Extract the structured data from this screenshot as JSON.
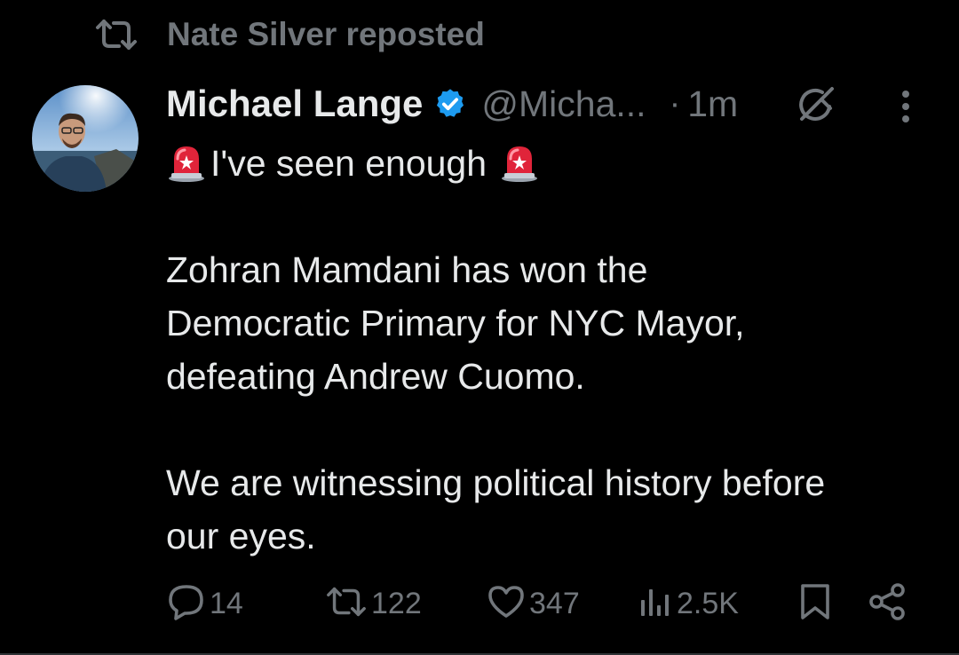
{
  "repost": {
    "icon": "repost-icon",
    "label": "Nate Silver reposted"
  },
  "author": {
    "avatar": "profile-photo",
    "name": "Michael Lange",
    "verified_icon": "verified-badge-icon",
    "verified_color": "#1d9bf0",
    "handle": "@Micha...",
    "separator": "·",
    "time": "1m"
  },
  "icons": {
    "grok": "grok-icon",
    "more": "more-options-icon",
    "siren": "police-siren-emoji"
  },
  "post": {
    "line1": "I've seen enough",
    "line2": "Zohran Mamdani has won the",
    "line3": "Democratic Primary for NYC Mayor,",
    "line4": "defeating Andrew Cuomo.",
    "line5": "We are witnessing political history before",
    "line6": "our eyes."
  },
  "actions": {
    "reply": {
      "icon": "reply-icon",
      "count": "14"
    },
    "repost": {
      "icon": "repost-icon",
      "count": "122"
    },
    "like": {
      "icon": "like-heart-icon",
      "count": "347"
    },
    "views": {
      "icon": "views-bar-chart-icon",
      "count": "2.5K"
    },
    "bookmark": {
      "icon": "bookmark-icon"
    },
    "share": {
      "icon": "share-icon"
    }
  },
  "colors": {
    "background": "#000000",
    "primary_text": "#e7e9ea",
    "secondary_text": "#71767b",
    "accent": "#1d9bf0"
  }
}
